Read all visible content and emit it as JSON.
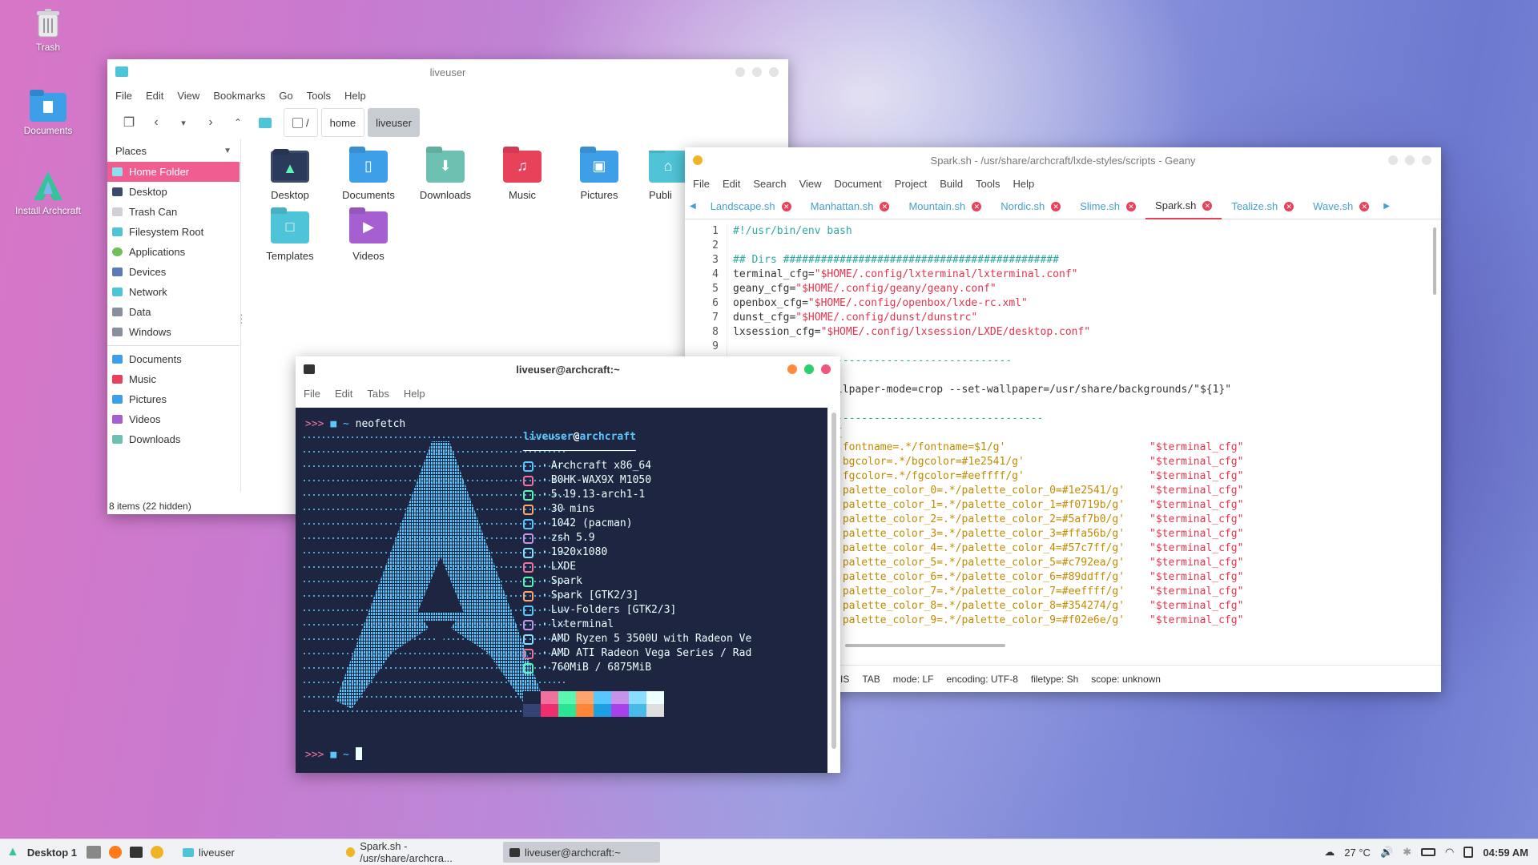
{
  "desktop": {
    "icons": [
      {
        "label": "Trash",
        "icon": "trash-icon"
      },
      {
        "label": "Documents",
        "icon": "folder-documents-icon"
      },
      {
        "label": "Install Archcraft",
        "icon": "archcraft-logo-icon"
      }
    ]
  },
  "filemanager": {
    "title": "liveuser",
    "menu": [
      "File",
      "Edit",
      "View",
      "Bookmarks",
      "Go",
      "Tools",
      "Help"
    ],
    "path": {
      "root": "/",
      "crumbs": [
        "home",
        "liveuser"
      ]
    },
    "places_header": "Places",
    "places": [
      "Home Folder",
      "Desktop",
      "Trash Can",
      "Filesystem Root",
      "Applications",
      "Devices",
      "Network",
      "Data",
      "Windows"
    ],
    "bookmarks": [
      "Documents",
      "Music",
      "Pictures",
      "Videos",
      "Downloads"
    ],
    "folders": [
      "Desktop",
      "Documents",
      "Downloads",
      "Music",
      "Pictures",
      "Publi",
      "Templates",
      "Videos"
    ],
    "status": "8 items (22 hidden)"
  },
  "geany": {
    "title": "Spark.sh - /usr/share/archcraft/lxde-styles/scripts - Geany",
    "menu": [
      "File",
      "Edit",
      "Search",
      "View",
      "Document",
      "Project",
      "Build",
      "Tools",
      "Help"
    ],
    "tabs": [
      "Landscape.sh",
      "Manhattan.sh",
      "Mountain.sh",
      "Nordic.sh",
      "Slime.sh",
      "Spark.sh",
      "Tealize.sh",
      "Wave.sh"
    ],
    "active_tab": "Spark.sh",
    "line_numbers": [
      "1",
      "2",
      "3",
      "4",
      "5",
      "6",
      "7",
      "8",
      "9"
    ],
    "lines": [
      {
        "a": "#!/usr/bin/env bash",
        "b": ""
      },
      {
        "a": "",
        "b": ""
      },
      {
        "a": "## Dirs ############################################",
        "b": ""
      },
      {
        "a": "terminal_cfg=",
        "b": "\"$HOME/.config/lxterminal/lxterminal.conf\""
      },
      {
        "a": "geany_cfg=",
        "b": "\"$HOME/.config/geany/geany.conf\""
      },
      {
        "a": "openbox_cfg=",
        "b": "\"$HOME/.config/openbox/lxde-rc.xml\""
      },
      {
        "a": "dunst_cfg=",
        "b": "\"$HOME/.config/dunst/dunstrc\""
      },
      {
        "a": "lxsession_cfg=",
        "b": "\"$HOME/.config/lxsession/LXDE/desktop.conf\""
      }
    ],
    "hidden_lines": [
      "----------------------------",
      "llpaper-mode=crop --set-wallpaper=/usr/share/backgrounds/\"${1}\"",
      "---------------------------------",
      "{",
      "'fontname=.*/fontname=$1/g'",
      "'bgcolor=.*/bgcolor=#1e2541/g'",
      "'fgcolor=.*/fgcolor=#eeffff/g'",
      "'palette_color_0=.*/palette_color_0=#1e2541/g'",
      "'palette_color_1=.*/palette_color_1=#f0719b/g'",
      "'palette_color_2=.*/palette_color_2=#5af7b0/g'",
      "'palette_color_3=.*/palette_color_3=#ffa56b/g'",
      "'palette_color_4=.*/palette_color_4=#57c7ff/g'",
      "'palette_color_5=.*/palette_color_5=#c792ea/g'",
      "'palette_color_6=.*/palette_color_6=#89ddff/g'",
      "'palette_color_7=.*/palette_color_7=#eeffff/g'",
      "'palette_color_8=.*/palette_color_8=#354274/g'",
      "'palette_color_9=.*/palette_color_9=#f02e6e/g'"
    ],
    "cfg_ref": "\"$terminal_cfg\"",
    "statusbar": [
      "IS",
      "TAB",
      "mode: LF",
      "encoding: UTF-8",
      "filetype: Sh",
      "scope: unknown"
    ]
  },
  "terminal": {
    "title": "liveuser@archcraft:~",
    "menu": [
      "File",
      "Edit",
      "Tabs",
      "Help"
    ],
    "prompt_prefix": ">>>",
    "prompt_dir": "~",
    "command": "neofetch",
    "user": "liveuser",
    "at": "@",
    "host": "archcraft",
    "underline": "──────────────────",
    "info": [
      "Archcraft x86_64",
      "B0HK-WAX9X M1050",
      "5.19.13-arch1-1",
      "30 mins",
      "1042 (pacman)",
      "zsh 5.9",
      "1920x1080",
      "LXDE",
      "Spark",
      "Spark [GTK2/3]",
      "Luv-Folders [GTK2/3]",
      "lxterminal",
      "AMD Ryzen 5 3500U with Radeon Ve",
      "AMD ATI Radeon Vega Series / Rad",
      "760MiB / 6875MiB"
    ],
    "info_icon_colors": [
      "#57c7ff",
      "#f0719b",
      "#5af7b0",
      "#ffa56b",
      "#57c7ff",
      "#c792ea",
      "#89ddff",
      "#f0719b",
      "#5af7b0",
      "#ffa56b",
      "#57c7ff",
      "#c792ea",
      "#89ddff",
      "#f0719b",
      "#5af7b0"
    ],
    "palette_top": [
      "#1e2541",
      "#f0719b",
      "#5af7b0",
      "#ffa56b",
      "#57c7ff",
      "#c792ea",
      "#89ddff",
      "#eeffff"
    ],
    "palette_bottom": [
      "#354274",
      "#f02e6e",
      "#2ce592",
      "#ff8537",
      "#1da0e2",
      "#a742ea",
      "#47bae8",
      "#dededf"
    ]
  },
  "taskbar": {
    "workspace": "Desktop 1",
    "tasks": [
      "liveuser",
      "Spark.sh - /usr/share/archcra...",
      "liveuser@archcraft:~"
    ],
    "weather": "27 °C",
    "clock": "04:59 AM"
  }
}
